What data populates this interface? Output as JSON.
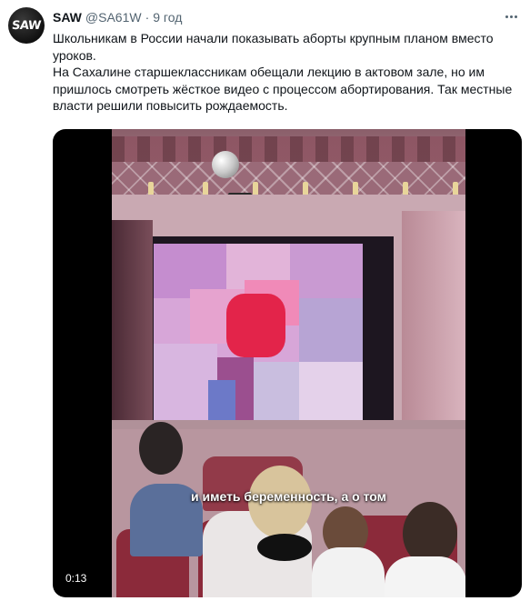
{
  "tweet": {
    "author": {
      "display_name": "SAW",
      "handle": "@SA61W",
      "time": "9 год",
      "avatar_text": "SAW"
    },
    "text_lines": [
      "Школьникам в России начали показывать аборты крупным планом вместо уроков.",
      "На Сахалине старшеклассникам обещали лекцию в актовом зале, но им пришлось смотреть жёсткое видео с процессом абортирования. Так местные власти решили повысить рождаемость."
    ],
    "media": {
      "type": "video",
      "subtitle": "и иметь беременность, а о том",
      "timestamp": "0:13"
    }
  },
  "colors": {
    "text": "#0f1419",
    "secondary_text": "#536471",
    "video_background": "#000000",
    "seat": "#8b2a3a"
  },
  "icons": {
    "more": "more-dots-icon"
  }
}
